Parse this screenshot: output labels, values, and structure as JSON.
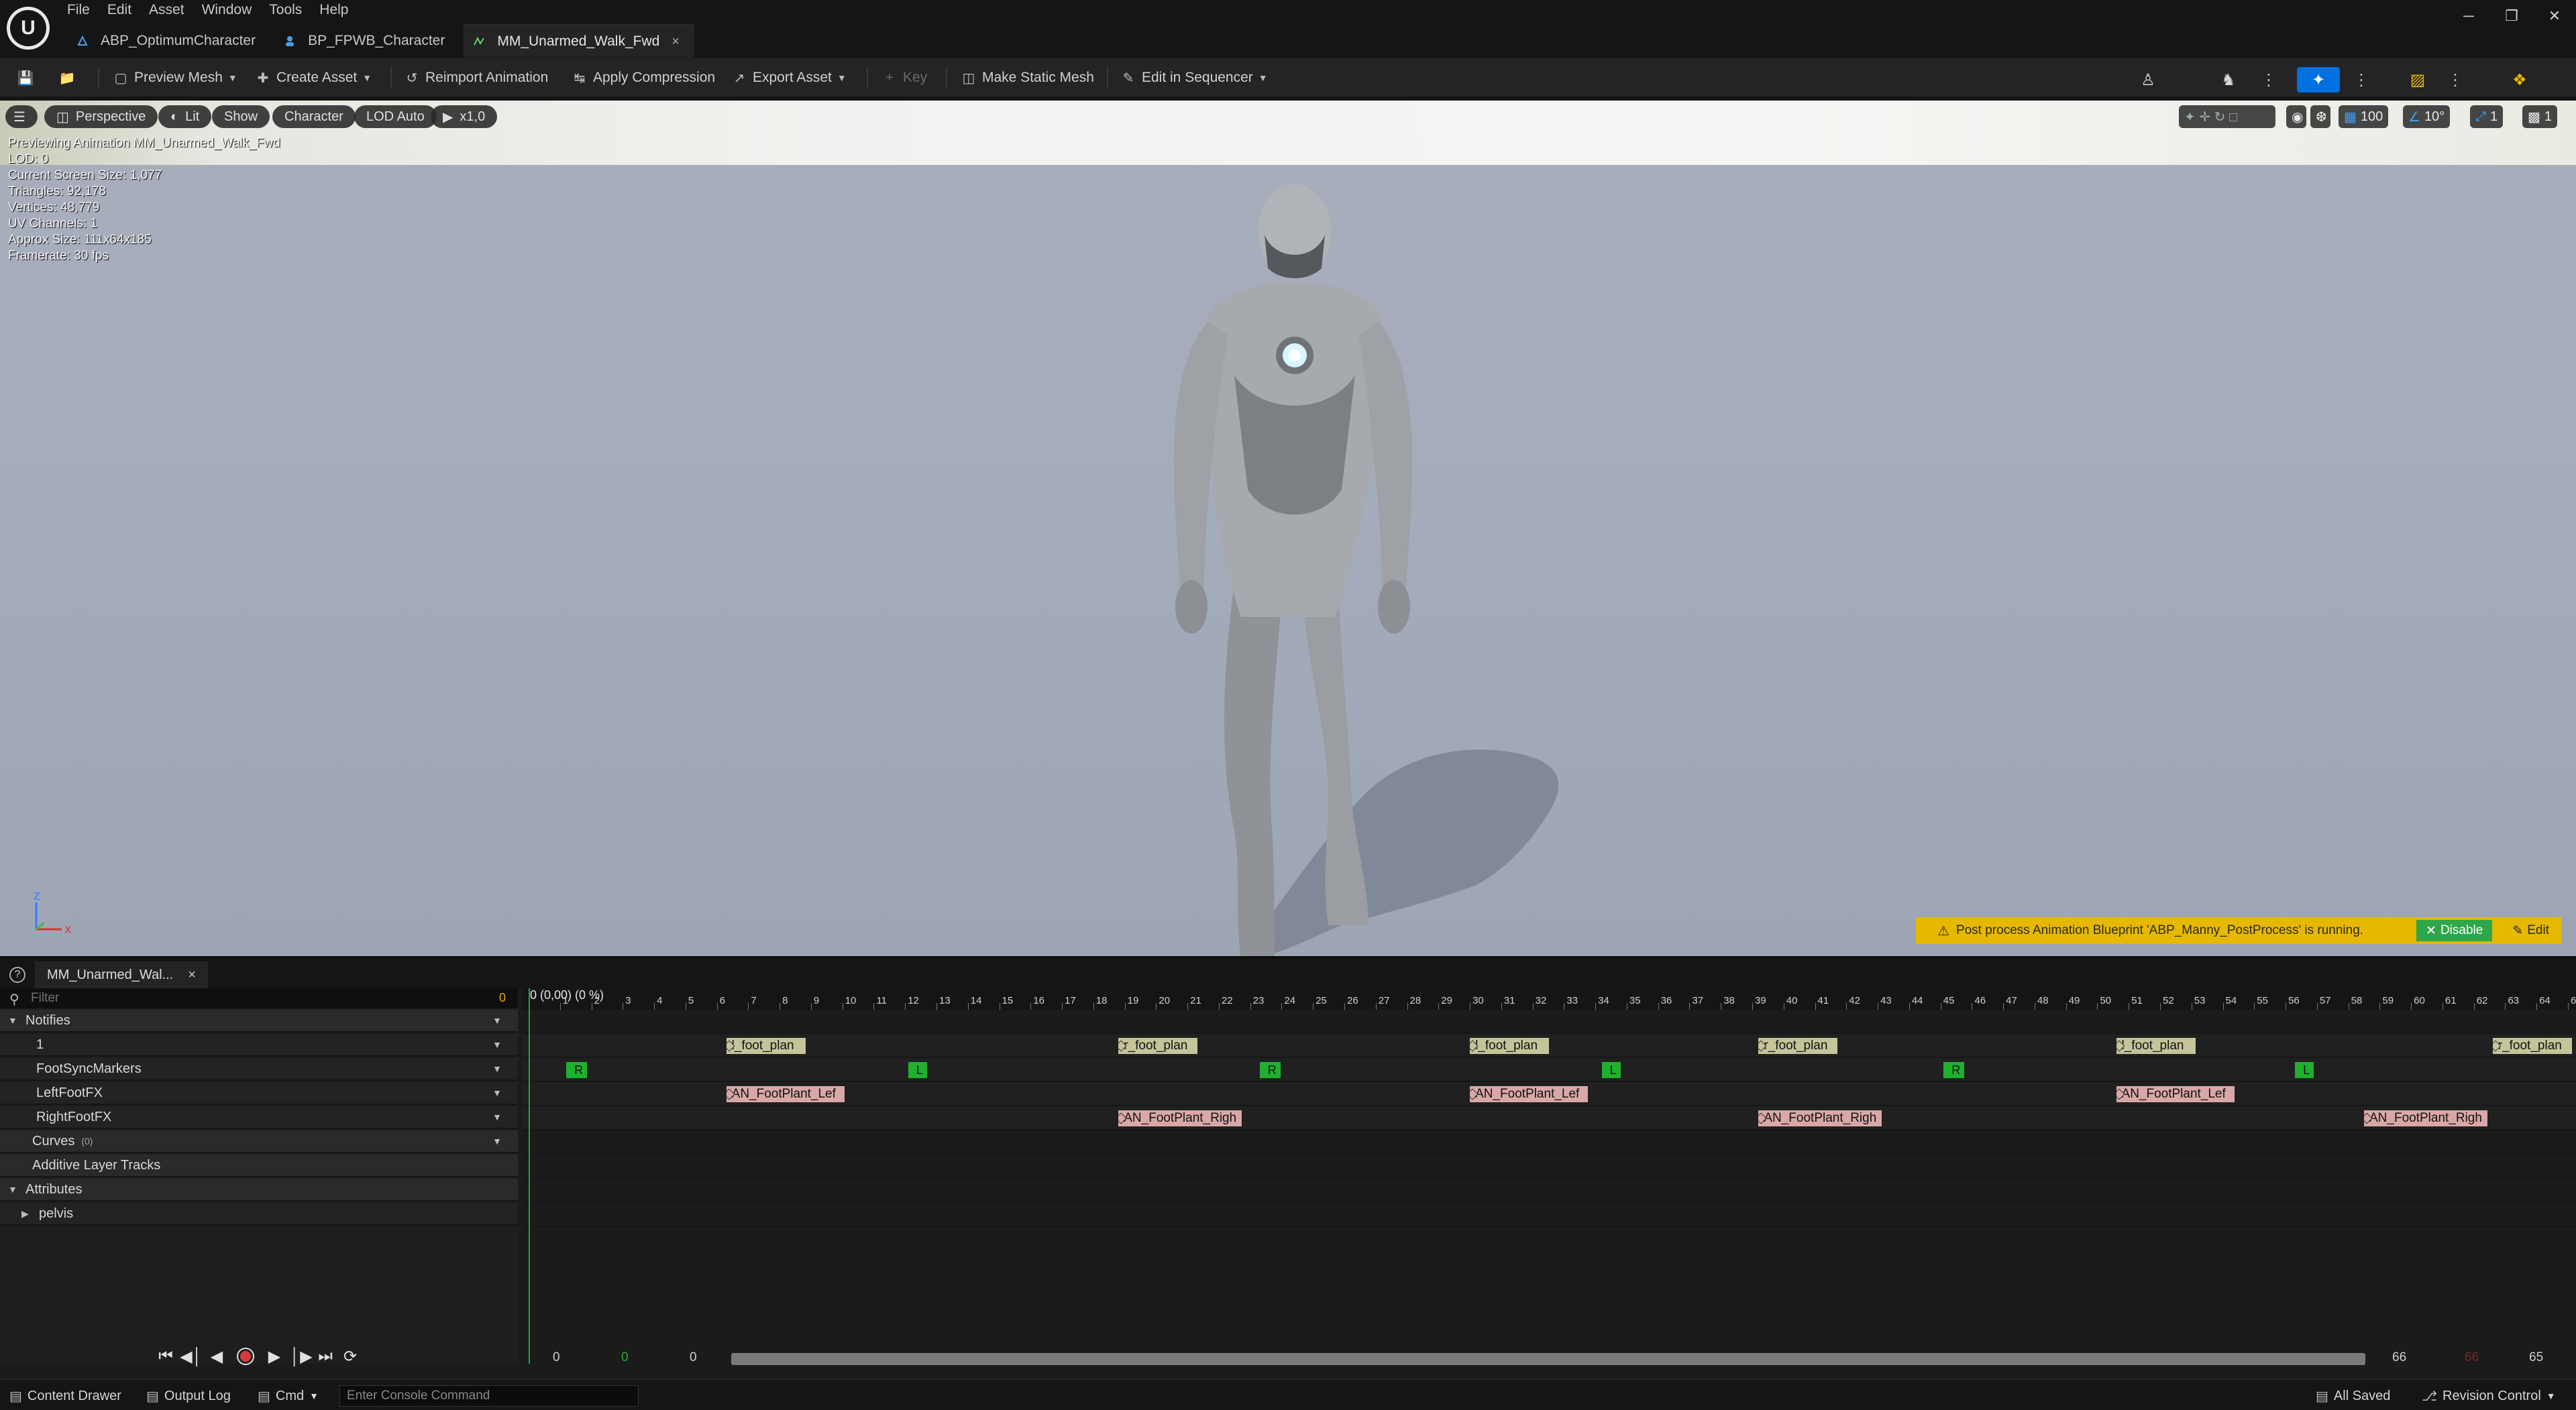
{
  "menu": [
    "File",
    "Edit",
    "Asset",
    "Window",
    "Tools",
    "Help"
  ],
  "doc_tabs": [
    {
      "label": "ABP_OptimumCharacter",
      "icon": "animblueprint-icon"
    },
    {
      "label": "BP_FPWB_Character",
      "icon": "blueprint-icon"
    },
    {
      "label": "MM_Unarmed_Walk_Fwd",
      "icon": "animsequence-icon",
      "close": "×"
    }
  ],
  "window_controls": [
    "─",
    "❐",
    "✕"
  ],
  "toolbar": {
    "preview_mesh": "Preview Mesh",
    "create_asset": "Create Asset",
    "reimport_animation": "Reimport Animation",
    "apply_compression": "Apply Compression",
    "export_asset": "Export Asset",
    "key": "Key",
    "make_static_mesh": "Make Static Mesh",
    "edit_in_sequencer": "Edit in Sequencer"
  },
  "viewport": {
    "toolbar": {
      "perspective": "Perspective",
      "lit": "Lit",
      "show": "Show",
      "character": "Character",
      "lod": "LOD Auto",
      "play_speed": "x1,0",
      "grid_size": "100",
      "angle_snap": "10°",
      "scale_snap": "1",
      "camera_speed": "1"
    },
    "info": [
      "Previewing Animation MM_Unarmed_Walk_Fwd",
      "LOD: 0",
      "Current Screen Size: 1,077",
      "Triangles: 92,178",
      "Vertices: 48,779",
      "UV Channels: 1",
      "Approx Size: 111x64x185",
      "Framerate: 30 fps"
    ],
    "axis": {
      "z": "Z",
      "x": "X"
    },
    "banner": {
      "message": "Post process Animation Blueprint 'ABP_Manny_PostProcess' is running.",
      "disable": "Disable",
      "edit": "Edit"
    }
  },
  "anim_panel": {
    "tab_label": "MM_Unarmed_Wal...",
    "tab_close": "×",
    "filter_placeholder": "Filter",
    "filter_count": "0",
    "time_readout": "0 (0,00) (0 %)",
    "tracks": {
      "notifies": "Notifies",
      "track_1": "1",
      "foot_sync_markers": "FootSyncMarkers",
      "left_foot_fx": "LeftFootFX",
      "right_foot_fx": "RightFootFX",
      "curves": "Curves",
      "curves_count": "(0)",
      "additive_layer_tracks": "Additive Layer Tracks",
      "attributes": "Attributes",
      "pelvis": "pelvis"
    },
    "ruler": {
      "total_frames": 65,
      "first_label": "0"
    },
    "notifies_row1": [
      {
        "label": "l_foot_plan",
        "frame": 6.3
      },
      {
        "label": "r_foot_plan",
        "frame": 18.8
      },
      {
        "label": "l_foot_plan",
        "frame": 30.0
      },
      {
        "label": "r_foot_plan",
        "frame": 39.2
      },
      {
        "label": "l_foot_plan",
        "frame": 50.6
      },
      {
        "label": "r_foot_plan",
        "frame": 62.6
      }
    ],
    "sync_markers": [
      {
        "label": "R",
        "frame": 1.2
      },
      {
        "label": "L",
        "frame": 12.1
      },
      {
        "label": "R",
        "frame": 23.3
      },
      {
        "label": "L",
        "frame": 34.2
      },
      {
        "label": "R",
        "frame": 45.1
      },
      {
        "label": "L",
        "frame": 56.3
      }
    ],
    "left_foot_fx": [
      {
        "label": "AN_FootPlant_Lef",
        "frame": 6.3
      },
      {
        "label": "AN_FootPlant_Lef",
        "frame": 30.0
      },
      {
        "label": "AN_FootPlant_Lef",
        "frame": 50.6
      }
    ],
    "right_foot_fx": [
      {
        "label": "AN_FootPlant_Righ",
        "frame": 18.8
      },
      {
        "label": "AN_FootPlant_Righ",
        "frame": 39.2
      },
      {
        "label": "AN_FootPlant_Righ",
        "frame": 58.5
      }
    ],
    "range": {
      "start": "0",
      "current": "0",
      "start2": "0",
      "end": "66",
      "end_red": "66",
      "end2": "65"
    }
  },
  "statusbar": {
    "content_drawer": "Content Drawer",
    "output_log": "Output Log",
    "cmd": "Cmd",
    "console_placeholder": "Enter Console Command",
    "all_saved": "All Saved",
    "revision_control": "Revision Control"
  }
}
